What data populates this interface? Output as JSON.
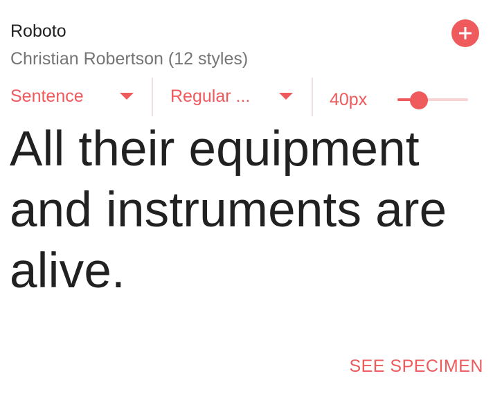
{
  "font": {
    "name": "Roboto",
    "designer_line": "Christian Robertson (12 styles)"
  },
  "actions": {
    "add_icon": "plus-icon",
    "see_specimen_label": "SEE SPECIMEN"
  },
  "controls": {
    "case_dropdown": {
      "selected": "Sentence",
      "icon": "chevron-down-icon"
    },
    "style_dropdown": {
      "selected": "Regular ...",
      "icon": "chevron-down-icon"
    },
    "size": {
      "label": "40px",
      "slider_fraction": 0.3
    }
  },
  "sample_text": "All their equipment and instruments are alive.",
  "colors": {
    "accent": "#ef5a5c",
    "track": "#f7d3d3",
    "text_primary": "#212121",
    "text_secondary": "#757575"
  }
}
